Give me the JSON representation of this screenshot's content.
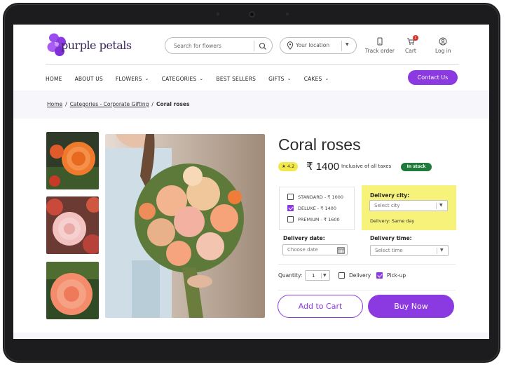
{
  "brand": {
    "name": "purple petals",
    "accent": "#8a3ae0"
  },
  "header": {
    "search_placeholder": "Search for flowers",
    "location_label": "Your location",
    "track_order": "Track order",
    "cart": "Cart",
    "cart_count": "2",
    "login": "Log in"
  },
  "nav": {
    "items": [
      "HOME",
      "ABOUT US",
      "FLOWERS",
      "CATEGORIES",
      "BEST SELLERS",
      "GIFTS",
      "CAKES"
    ],
    "contact": "Contact Us"
  },
  "breadcrumb": {
    "home": "Home",
    "category": "Categories - Corporate Gifting",
    "current": "Coral roses"
  },
  "product": {
    "title": "Coral roses",
    "rating": "★ 4.2",
    "price": "₹ 1400",
    "taxes": "Inclusive of all taxes",
    "stock": "In stock",
    "options": [
      "STANDARD - ₹ 1000",
      "DELUXE - ₹ 1400",
      "PREMIUM - ₹ 1600"
    ],
    "selected_option": "DELUXE - ₹ 1400",
    "delivery_city_label": "Delivery city:",
    "city_placeholder": "Select city",
    "city_note": "Delivery: Same day",
    "delivery_date_label": "Delivery date:",
    "date_placeholder": "Choose date",
    "delivery_time_label": "Delivery time:",
    "time_placeholder": "Select time",
    "quantity_label": "Quantity:",
    "quantity": "1",
    "delivery_check": "Delivery",
    "pickup_check": "Pick-up",
    "add_to_cart": "Add to Cart",
    "buy_now": "Buy Now"
  },
  "icons": [
    "search-icon",
    "location-pin-icon",
    "phone-icon",
    "cart-icon",
    "user-icon",
    "calendar-icon",
    "star-icon"
  ]
}
